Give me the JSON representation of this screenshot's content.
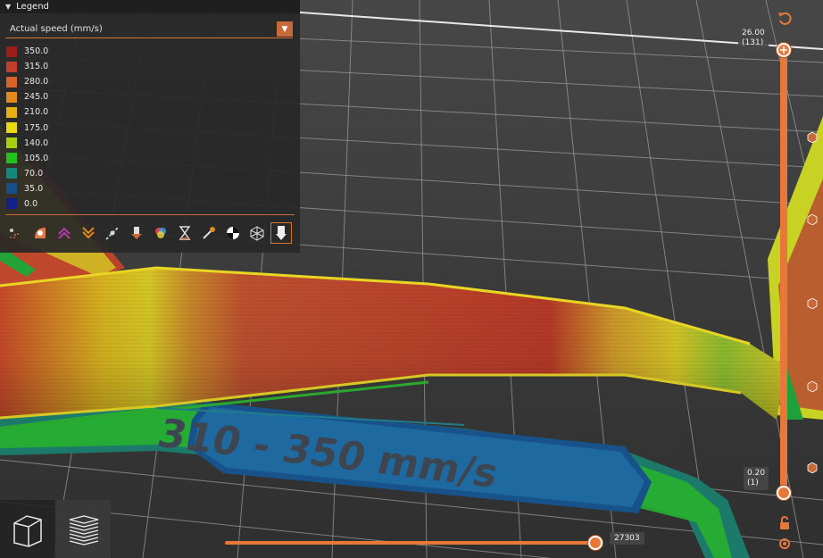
{
  "legend": {
    "title": "Legend",
    "view_type": "Actual speed (mm/s)",
    "items": [
      {
        "label": "350.0",
        "color": "#9b1e1a"
      },
      {
        "label": "315.0",
        "color": "#c33e2f"
      },
      {
        "label": "280.0",
        "color": "#d8642a"
      },
      {
        "label": "245.0",
        "color": "#e0891d"
      },
      {
        "label": "210.0",
        "color": "#e5b112"
      },
      {
        "label": "175.0",
        "color": "#e8d80c"
      },
      {
        "label": "140.0",
        "color": "#a5d10e"
      },
      {
        "label": "105.0",
        "color": "#21c21c"
      },
      {
        "label": "70.0",
        "color": "#16877e"
      },
      {
        "label": "35.0",
        "color": "#175088"
      },
      {
        "label": "0.0",
        "color": "#12208a"
      }
    ],
    "tool_icons": [
      "travel-icon",
      "wipe-icon",
      "retractions-icon",
      "deretractions-icon",
      "seams-icon",
      "tool-changes-icon",
      "color-changes-icon",
      "pause-prints-icon",
      "custom-gcodes-icon",
      "center-of-gravity-icon",
      "shells-icon",
      "tool-marker-icon"
    ]
  },
  "vertical_slider": {
    "top_value": "26.00",
    "top_layer": "(131)",
    "bottom_value": "0.20",
    "bottom_layer": "(1)"
  },
  "horizontal_slider": {
    "value": "27303"
  },
  "model_text": "310 - 350 mm/s",
  "accent": "#e8783a"
}
